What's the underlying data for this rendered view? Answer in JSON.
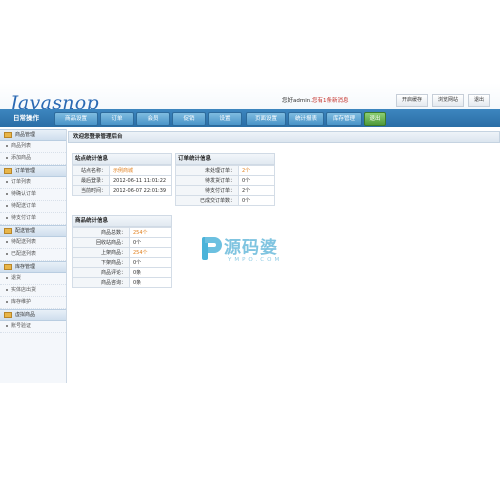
{
  "logo": "Javasnop",
  "user": {
    "greeting": "您好",
    "name": "admin",
    "separator": ".",
    "messages": "您有1条新消息"
  },
  "top_buttons": [
    "开启缓存",
    "浏览网站",
    "退出"
  ],
  "nav": {
    "home": "日常操作",
    "tabs": [
      {
        "label": "商品设置",
        "active": false
      },
      {
        "label": "订单",
        "active": false
      },
      {
        "label": "会员",
        "active": false
      },
      {
        "label": "促销",
        "active": false
      },
      {
        "label": "设置",
        "active": false
      },
      {
        "label": "页面设置",
        "active": false
      },
      {
        "label": "统计报表",
        "active": false
      },
      {
        "label": "库存管理",
        "active": false
      },
      {
        "label": "退出",
        "active": true
      }
    ]
  },
  "sidebar": {
    "groups": [
      {
        "title": "商品管理",
        "items": [
          "商品列表",
          "添加商品"
        ]
      },
      {
        "title": "订单管理",
        "items": [
          "订单列表",
          "待确认订单",
          "待配送订单",
          "待支付订单"
        ]
      },
      {
        "title": "配送管理",
        "items": [
          "待配送列表",
          "已配送列表"
        ]
      },
      {
        "title": "库存管理",
        "items": [
          "退货",
          "实体店出货",
          "库存维护"
        ]
      },
      {
        "title": "虚拟商品",
        "items": [
          "账号验证"
        ]
      }
    ]
  },
  "welcome": "欢迎您登录管理后台",
  "site_info": {
    "title": "站点统计信息",
    "rows": [
      {
        "label": "站点名称：",
        "value": "示例商城",
        "highlight": true
      },
      {
        "label": "最后登录：",
        "value": "2012-06-11 11:01:22",
        "highlight": false
      },
      {
        "label": "当前时间：",
        "value": "2012-06-07 22:01:39",
        "highlight": false
      }
    ]
  },
  "order_info": {
    "title": "订单统计信息",
    "rows": [
      {
        "label": "未处理订单：",
        "value": "2个",
        "highlight": true
      },
      {
        "label": "待发货订单：",
        "value": "0个",
        "highlight": false
      },
      {
        "label": "待支付订单：",
        "value": "2个",
        "highlight": false
      },
      {
        "label": "已成交订单数：",
        "value": "0个",
        "highlight": false
      }
    ]
  },
  "goods_info": {
    "title": "商品统计信息",
    "rows": [
      {
        "label": "商品总数：",
        "value": "254个",
        "highlight": true
      },
      {
        "label": "回收站商品：",
        "value": "0个",
        "highlight": false
      },
      {
        "label": "上架商品：",
        "value": "254个",
        "highlight": true
      },
      {
        "label": "下架商品：",
        "value": "0个",
        "highlight": false
      },
      {
        "label": "商品评论：",
        "value": "0条",
        "highlight": false
      },
      {
        "label": "商品咨询：",
        "value": "0条",
        "highlight": false
      }
    ]
  },
  "watermark": {
    "title": "源码婆",
    "sub": "YMPO.COM"
  }
}
